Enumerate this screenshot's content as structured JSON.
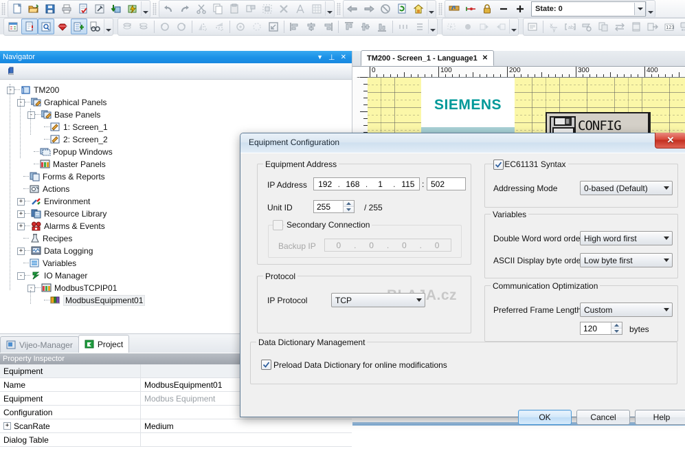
{
  "app": {
    "toolbar_rows": [
      {
        "groups": [
          {
            "buttons": [
              {
                "name": "new-file-icon",
                "icon": "page"
              },
              {
                "name": "open-folder-icon",
                "icon": "folder"
              },
              {
                "name": "save-icon",
                "icon": "save"
              },
              {
                "name": "print-icon",
                "icon": "print"
              },
              {
                "name": "edit-page-icon",
                "icon": "page-check"
              },
              {
                "name": "build-icon",
                "icon": "wrench"
              },
              {
                "name": "download-icon",
                "icon": "download"
              },
              {
                "name": "run-icon",
                "icon": "lightning"
              }
            ]
          },
          {
            "buttons": [
              {
                "name": "undo-icon",
                "icon": "undo"
              },
              {
                "name": "redo-icon",
                "icon": "redo"
              },
              {
                "name": "cut-icon",
                "icon": "scissors"
              },
              {
                "name": "copy-icon",
                "icon": "copy"
              },
              {
                "name": "paste-icon",
                "icon": "paste"
              },
              {
                "name": "duplicate-icon",
                "icon": "dup"
              },
              {
                "name": "group-icon",
                "icon": "group"
              },
              {
                "name": "delete-icon",
                "icon": "x"
              },
              {
                "name": "font-icon",
                "icon": "letterA"
              },
              {
                "name": "table-icon",
                "icon": "tablegrid"
              }
            ]
          },
          {
            "buttons": [
              {
                "name": "back-arrow-icon",
                "icon": "arrowleft"
              },
              {
                "name": "forward-arrow-icon",
                "icon": "arrowright"
              },
              {
                "name": "stop-icon",
                "icon": "circlex"
              },
              {
                "name": "refresh-icon",
                "icon": "refresh"
              },
              {
                "name": "home-icon",
                "icon": "home"
              }
            ]
          },
          {
            "buttons": [
              {
                "name": "select-tool-icon",
                "icon": "hand"
              },
              {
                "name": "link-icon",
                "icon": "link"
              },
              {
                "name": "lock-icon",
                "icon": "lock"
              },
              {
                "name": "zoom-out-icon",
                "icon": "minus"
              },
              {
                "name": "zoom-in-icon",
                "icon": "plus"
              }
            ]
          }
        ],
        "state_label": "State: 0"
      },
      {
        "groups": [
          {
            "buttons": [
              {
                "name": "properties-icon",
                "icon": "props"
              },
              {
                "name": "report-icon",
                "icon": "pagebang",
                "selected": true
              },
              {
                "name": "preview-icon",
                "icon": "magnify",
                "selected": true
              },
              {
                "name": "ruby-icon",
                "icon": "gem"
              },
              {
                "name": "insert-icon",
                "icon": "insertplus",
                "selected": true
              },
              {
                "name": "find-icon",
                "icon": "binoculars"
              }
            ]
          },
          {
            "buttons": [
              {
                "name": "bring-front-icon",
                "icon": "stackup"
              },
              {
                "name": "send-back-icon",
                "icon": "stackdown"
              },
              {
                "name": "rotate-left-icon",
                "icon": "rotl"
              },
              {
                "name": "rotate-right-icon",
                "icon": "rotr"
              },
              {
                "name": "flip-horizontal-icon",
                "icon": "fliph"
              },
              {
                "name": "flip-vertical-icon",
                "icon": "flipv"
              },
              {
                "name": "scale-icon",
                "icon": "scale"
              },
              {
                "name": "fit-icon",
                "icon": "fit"
              },
              {
                "name": "resize-icon",
                "icon": "resize"
              },
              {
                "name": "align-left-icon",
                "icon": "alignl"
              },
              {
                "name": "align-center-icon",
                "icon": "alignc"
              },
              {
                "name": "align-right-icon",
                "icon": "alignr"
              },
              {
                "name": "align-top-icon",
                "icon": "alignt"
              },
              {
                "name": "align-middle-icon",
                "icon": "alignm"
              },
              {
                "name": "align-bottom-icon",
                "icon": "alignb"
              },
              {
                "name": "distribute-h-icon",
                "icon": "disth"
              },
              {
                "name": "distribute-v-icon",
                "icon": "distv"
              }
            ]
          },
          {
            "buttons": [
              {
                "name": "anim-start-icon",
                "icon": "animstart"
              },
              {
                "name": "anim-step-icon",
                "icon": "animstep"
              },
              {
                "name": "anim-record-icon",
                "icon": "animrec"
              },
              {
                "name": "anim-stop-icon",
                "icon": "animstop"
              },
              {
                "name": "anim-prev-icon",
                "icon": "animprev"
              },
              {
                "name": "anim-next-icon",
                "icon": "animnext"
              }
            ]
          },
          {
            "buttons": [
              {
                "name": "text-object-icon",
                "icon": "textobj"
              },
              {
                "name": "variable-icon",
                "icon": "xy"
              },
              {
                "name": "array-icon",
                "icon": "brackets"
              },
              {
                "name": "script-icon",
                "icon": "script"
              },
              {
                "name": "copies-icon",
                "icon": "copies"
              },
              {
                "name": "swap-icon",
                "icon": "swap"
              },
              {
                "name": "film-icon",
                "icon": "film"
              },
              {
                "name": "export-icon",
                "icon": "export"
              },
              {
                "name": "numeric-icon",
                "icon": "num123"
              },
              {
                "name": "keypad-icon",
                "icon": "keypad"
              }
            ]
          }
        ]
      }
    ]
  },
  "navigator": {
    "title": "Navigator",
    "header_buttons": [
      {
        "name": "navigator-dropdown-icon",
        "glyph": "▼"
      },
      {
        "name": "navigator-pin-icon",
        "glyph": "⊥"
      },
      {
        "name": "navigator-close-icon",
        "glyph": "✕"
      }
    ],
    "toolbar_button": {
      "name": "navigator-build-icon"
    },
    "tree": [
      {
        "label": "TM200",
        "indent": 0,
        "toggle": "-",
        "icon": "cube"
      },
      {
        "label": "Graphical Panels",
        "indent": 1,
        "toggle": "-",
        "icon": "panels"
      },
      {
        "label": "Base Panels",
        "indent": 2,
        "toggle": "-",
        "icon": "panels"
      },
      {
        "label": "1: Screen_1",
        "indent": 3,
        "toggle": "",
        "icon": "pencil"
      },
      {
        "label": "2: Screen_2",
        "indent": 3,
        "toggle": "",
        "icon": "pencil"
      },
      {
        "label": "Popup Windows",
        "indent": 2,
        "toggle": "",
        "icon": "popup"
      },
      {
        "label": "Master Panels",
        "indent": 2,
        "toggle": "",
        "icon": "master"
      },
      {
        "label": "Forms & Reports",
        "indent": 1,
        "toggle": "",
        "icon": "forms"
      },
      {
        "label": "Actions",
        "indent": 1,
        "toggle": "",
        "icon": "actions"
      },
      {
        "label": "Environment",
        "indent": 1,
        "toggle": "+",
        "icon": "tools"
      },
      {
        "label": "Resource Library",
        "indent": 1,
        "toggle": "+",
        "icon": "library"
      },
      {
        "label": "Alarms & Events",
        "indent": 1,
        "toggle": "+",
        "icon": "alarms"
      },
      {
        "label": "Recipes",
        "indent": 1,
        "toggle": "",
        "icon": "flask"
      },
      {
        "label": "Data Logging",
        "indent": 1,
        "toggle": "+",
        "icon": "logging"
      },
      {
        "label": "Variables",
        "indent": 1,
        "toggle": "",
        "icon": "variables"
      },
      {
        "label": "IO Manager",
        "indent": 1,
        "toggle": "-",
        "icon": "iomanager"
      },
      {
        "label": "ModbusTCPIP01",
        "indent": 2,
        "toggle": "-",
        "icon": "master"
      },
      {
        "label": "ModbusEquipment01",
        "indent": 3,
        "toggle": "",
        "icon": "equipment",
        "selected": true
      }
    ],
    "tabs": [
      {
        "label": "Vijeo-Manager",
        "active": false,
        "icon": "vijeo"
      },
      {
        "label": "Project",
        "active": true,
        "icon": "project"
      }
    ]
  },
  "property_inspector": {
    "title": "Property Inspector",
    "rows": [
      {
        "key": "Equipment",
        "value": "",
        "category": true
      },
      {
        "key": "Name",
        "value": "ModbusEquipment01"
      },
      {
        "key": "Equipment",
        "value": "Modbus Equipment",
        "muted": true
      },
      {
        "key": "Configuration",
        "value": ""
      },
      {
        "key": "ScanRate",
        "value": "Medium",
        "expander": "+"
      },
      {
        "key": "Dialog Table",
        "value": ""
      }
    ]
  },
  "editor": {
    "tab": {
      "label": "TM200 - Screen_1 - Language1",
      "close_glyph": "✕"
    },
    "ruler": {
      "labels": [
        "0",
        "100",
        "200",
        "300",
        "400"
      ],
      "spacing_px": 100
    },
    "canvas": {
      "logo_text": "SIEMENS",
      "button_label": "CONFIG"
    }
  },
  "dialog": {
    "title": "Equipment Configuration",
    "close_glyph": "✕",
    "watermark": "BLAJA.cz",
    "equipment_address": {
      "caption": "Equipment Address",
      "ip_label": "IP Address",
      "ip_octets": [
        "192",
        "168",
        "1",
        "115"
      ],
      "port": "502",
      "unit_id_label": "Unit ID",
      "unit_id": "255",
      "unit_id_max": "/ 255",
      "secondary_label": "Secondary Connection",
      "secondary_checked": false,
      "backup_label": "Backup IP",
      "backup_octets": [
        "0",
        "0",
        "0",
        "0"
      ]
    },
    "protocol": {
      "caption": "Protocol",
      "label": "IP Protocol",
      "value": "TCP"
    },
    "data_dictionary": {
      "caption": "Data Dictionary Management",
      "checkbox_label": "Preload Data Dictionary for online modifications",
      "checked": true
    },
    "syntax": {
      "caption": "IEC61131 Syntax",
      "checked": true,
      "addressing_label": "Addressing Mode",
      "addressing_value": "0-based (Default)"
    },
    "variables": {
      "caption": "Variables",
      "dword_label": "Double Word word order",
      "dword_value": "High word first",
      "ascii_label": "ASCII Display byte order",
      "ascii_value": "Low byte first"
    },
    "comm_optimization": {
      "caption": "Communication Optimization",
      "frame_label": "Preferred Frame Length",
      "frame_value": "Custom",
      "bytes_value": "120",
      "bytes_unit": "bytes"
    },
    "buttons": [
      {
        "label": "OK",
        "default": true,
        "name": "ok-button"
      },
      {
        "label": "Cancel",
        "default": false,
        "name": "cancel-button"
      },
      {
        "label": "Help",
        "default": false,
        "name": "help-button"
      }
    ]
  }
}
